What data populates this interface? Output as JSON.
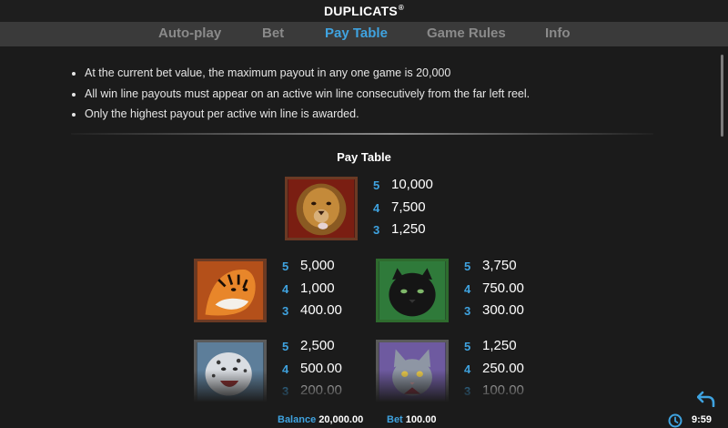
{
  "app": {
    "title": "DUPLICATS",
    "title_mark": "®"
  },
  "tabs": [
    {
      "label": "Auto-play",
      "active": false
    },
    {
      "label": "Bet",
      "active": false
    },
    {
      "label": "Pay Table",
      "active": true
    },
    {
      "label": "Game Rules",
      "active": false
    },
    {
      "label": "Info",
      "active": false
    }
  ],
  "rules": [
    "At the current bet value, the maximum payout in any one game is 20,000",
    "All win line payouts must appear on an active win line consecutively from the far left reel.",
    "Only the highest payout per active win line is awarded."
  ],
  "paytable": {
    "title": "Pay Table",
    "symbols": [
      {
        "icon": "lion-icon",
        "pays": [
          {
            "count": "5",
            "value": "10,000"
          },
          {
            "count": "4",
            "value": "7,500"
          },
          {
            "count": "3",
            "value": "1,250"
          }
        ]
      },
      {
        "icon": "tiger-icon",
        "pays": [
          {
            "count": "5",
            "value": "5,000"
          },
          {
            "count": "4",
            "value": "1,000"
          },
          {
            "count": "3",
            "value": "400.00"
          }
        ]
      },
      {
        "icon": "black-panther-icon",
        "pays": [
          {
            "count": "5",
            "value": "3,750"
          },
          {
            "count": "4",
            "value": "750.00"
          },
          {
            "count": "3",
            "value": "300.00"
          }
        ]
      },
      {
        "icon": "snow-leopard-icon",
        "pays": [
          {
            "count": "5",
            "value": "2,500"
          },
          {
            "count": "4",
            "value": "500.00"
          },
          {
            "count": "3",
            "value": "200.00"
          }
        ]
      },
      {
        "icon": "grey-cat-icon",
        "pays": [
          {
            "count": "5",
            "value": "1,250"
          },
          {
            "count": "4",
            "value": "250.00"
          },
          {
            "count": "3",
            "value": "100.00"
          }
        ]
      }
    ]
  },
  "footer": {
    "balance_label": "Balance",
    "balance_value": "20,000.00",
    "bet_label": "Bet",
    "bet_value": "100.00",
    "clock": "9:59"
  },
  "colors": {
    "accent": "#3fa3e0",
    "tab_inactive": "#8a8a8a",
    "background": "#1b1b1b",
    "tab_bar": "#3a3a3a"
  }
}
